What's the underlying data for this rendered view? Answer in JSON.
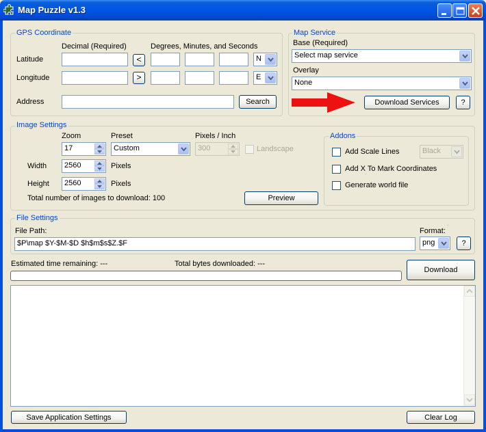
{
  "window": {
    "title": "Map Puzzle v1.3"
  },
  "gps": {
    "legend": "GPS Coordinate",
    "decimal_header": "Decimal (Required)",
    "dms_header": "Degrees, Minutes, and Seconds",
    "latitude_label": "Latitude",
    "longitude_label": "Longitude",
    "address_label": "Address",
    "latitude_value": "",
    "longitude_value": "",
    "address_value": "",
    "lat_dir": "N",
    "lon_dir": "E",
    "lat_convert": "<",
    "lon_convert": ">",
    "search_label": "Search"
  },
  "map_service": {
    "legend": "Map Service",
    "base_label": "Base (Required)",
    "base_value": "Select map service",
    "overlay_label": "Overlay",
    "overlay_value": "None",
    "download_services_label": "Download Services",
    "help_label": "?"
  },
  "image": {
    "legend": "Image Settings",
    "zoom_label": "Zoom",
    "zoom_value": "17",
    "preset_label": "Preset",
    "preset_value": "Custom",
    "ppi_label": "Pixels / Inch",
    "ppi_value": "300",
    "landscape_label": "Landscape",
    "width_label": "Width",
    "width_value": "2560",
    "height_label": "Height",
    "height_value": "2560",
    "pixels_unit": "Pixels",
    "total_text": "Total number of images to download: 100",
    "preview_label": "Preview"
  },
  "addons": {
    "legend": "Addons",
    "scale_lines_label": "Add Scale Lines",
    "color_value": "Black",
    "mark_label": "Add X To Mark Coordinates",
    "world_file_label": "Generate world file"
  },
  "file": {
    "legend": "File Settings",
    "path_label": "File Path:",
    "path_value": "$P\\map $Y-$M-$D $h$m$s$Z.$F",
    "format_label": "Format:",
    "format_value": "png",
    "help_label": "?"
  },
  "status": {
    "eta_text": "Estimated time remaining: ---",
    "bytes_text": "Total bytes downloaded: ---",
    "download_label": "Download",
    "progress": 0
  },
  "footer": {
    "save_label": "Save Application Settings",
    "clear_label": "Clear Log"
  },
  "colors": {
    "legend": "#0046d5",
    "titlebar": "#0055e5",
    "arrow": "#ee1111"
  }
}
